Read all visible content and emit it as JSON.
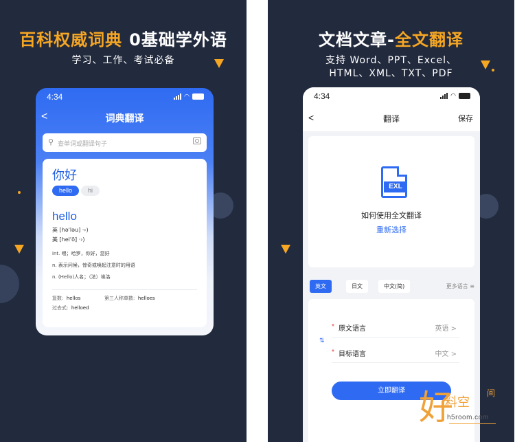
{
  "left_panel": {
    "headline_orange": "百科权威词典",
    "headline_white": "0基础学外语",
    "subheadline": "学习、工作、考试必备",
    "phone": {
      "status_time": "4:34",
      "nav_title": "词典翻译",
      "back_label": "<",
      "search_placeholder": "查单词或翻译句子",
      "card": {
        "query_word": "你好",
        "chip_active": "hello",
        "chip_inactive": "hi",
        "headword": "hello",
        "phonetic_uk": "英 [hə'ləu] ·›)",
        "phonetic_us": "美 [hel'ō] ·›)",
        "definitions": [
          "int. 喂；哈罗，你好，您好",
          "n. 表示问候，惊奇或唤起注意时的用语",
          "n. (Hello)人名；（法）埃洛"
        ],
        "plural_label": "复数:",
        "plural_value": "hellos",
        "third_person_label": "第三人称单数:",
        "third_person_value": "helloes",
        "past_label": "过去式:",
        "past_value": "helloed"
      }
    }
  },
  "right_panel": {
    "headline_white": "文档文章-",
    "headline_orange": "全文翻译",
    "subheadline_line1": "支持 Word、PPT、Excel、",
    "subheadline_line2": "HTML、XML、TXT、PDF",
    "phone": {
      "status_time": "4:34",
      "nav_title": "翻译",
      "back_label": "<",
      "save_label": "保存",
      "file_tag": "EXL",
      "how_to_text": "如何使用全文翻译",
      "reselect_text": "重新选择",
      "language_tabs": [
        "英文",
        "日文",
        "中文(简)"
      ],
      "more_languages": "更多语言 ≡",
      "source_language_label": "原文语言",
      "source_language_value": "英语 >",
      "target_language_label": "目标语言",
      "target_language_value": "中文 >",
      "required_mark": "*",
      "swap_icon_glyph": "⇅",
      "translate_button": "立即翻译"
    }
  },
  "watermark": {
    "char_big": "好",
    "char_mid": "料空",
    "char_small": "间",
    "domain": "h5room.com"
  },
  "colors": {
    "background_dark": "#222a3d",
    "accent_orange": "#f5a623",
    "brand_blue": "#2f6bf2",
    "required_red": "#e53935"
  }
}
